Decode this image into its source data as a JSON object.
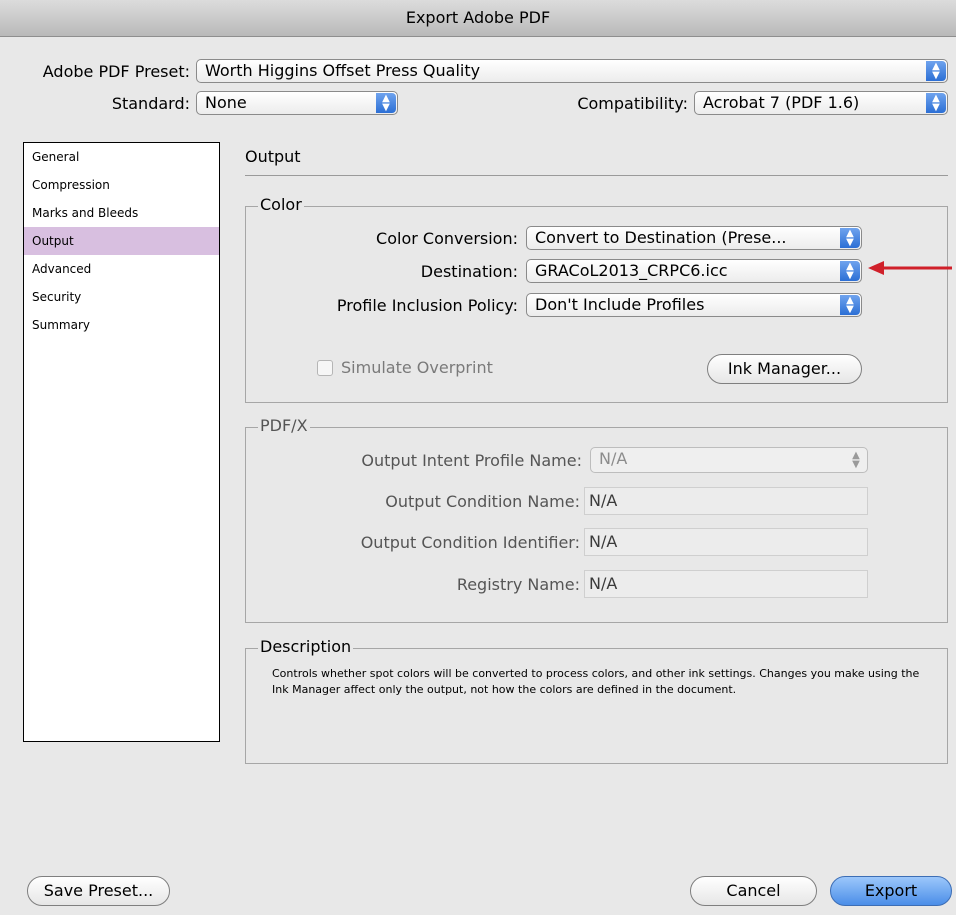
{
  "window": {
    "title": "Export Adobe PDF"
  },
  "preset": {
    "label": "Adobe PDF Preset:",
    "value": "Worth Higgins Offset Press Quality"
  },
  "standard": {
    "label": "Standard:",
    "value": "None"
  },
  "compatibility": {
    "label": "Compatibility:",
    "value": "Acrobat 7 (PDF 1.6)"
  },
  "sidebar": {
    "items": [
      {
        "label": "General"
      },
      {
        "label": "Compression"
      },
      {
        "label": "Marks and Bleeds"
      },
      {
        "label": "Output",
        "selected": true
      },
      {
        "label": "Advanced"
      },
      {
        "label": "Security"
      },
      {
        "label": "Summary"
      }
    ]
  },
  "panel": {
    "title": "Output"
  },
  "color": {
    "title": "Color",
    "conversion": {
      "label": "Color Conversion:",
      "value": "Convert to Destination (Prese..."
    },
    "destination": {
      "label": "Destination:",
      "value": "GRACoL2013_CRPC6.icc"
    },
    "profile": {
      "label": "Profile Inclusion Policy:",
      "value": "Don't Include Profiles"
    },
    "simulate_overprint": {
      "label": "Simulate Overprint",
      "checked": false,
      "enabled": false
    },
    "ink_manager_label": "Ink Manager..."
  },
  "pdfx": {
    "title": "PDF/X",
    "intent_profile": {
      "label": "Output Intent Profile Name:",
      "value": "N/A"
    },
    "condition_name": {
      "label": "Output Condition Name:",
      "value": "N/A"
    },
    "condition_identifier": {
      "label": "Output Condition Identifier:",
      "value": "N/A"
    },
    "registry_name": {
      "label": "Registry Name:",
      "value": "N/A"
    }
  },
  "description": {
    "title": "Description",
    "text": "Controls whether spot colors will be converted to process colors, and other ink settings. Changes you make using the Ink Manager affect only the output, not how the colors are defined in the document."
  },
  "buttons": {
    "save_preset": "Save Preset...",
    "cancel": "Cancel",
    "export": "Export"
  },
  "colors": {
    "accent_arrow": "#d0202a",
    "selection": "#d8bfe0",
    "popup_arrows": "#2c6fd5"
  }
}
